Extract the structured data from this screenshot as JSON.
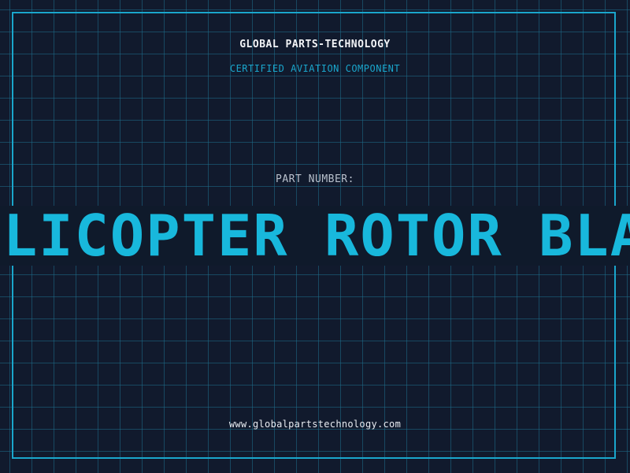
{
  "header": {
    "brand": "GLOBAL PARTS-TECHNOLOGY",
    "subtitle": "CERTIFIED AVIATION COMPONENT"
  },
  "part": {
    "label": "PART NUMBER:",
    "name": "HELICOPTER ROTOR BLADE"
  },
  "footer": {
    "url": "www.globalpartstechnology.com"
  },
  "colors": {
    "background": "#111a2d",
    "accent": "#1aa6cc",
    "part_name": "#18b8dc",
    "text_light": "#f2f4f7",
    "text_muted": "#b8c0cc"
  }
}
